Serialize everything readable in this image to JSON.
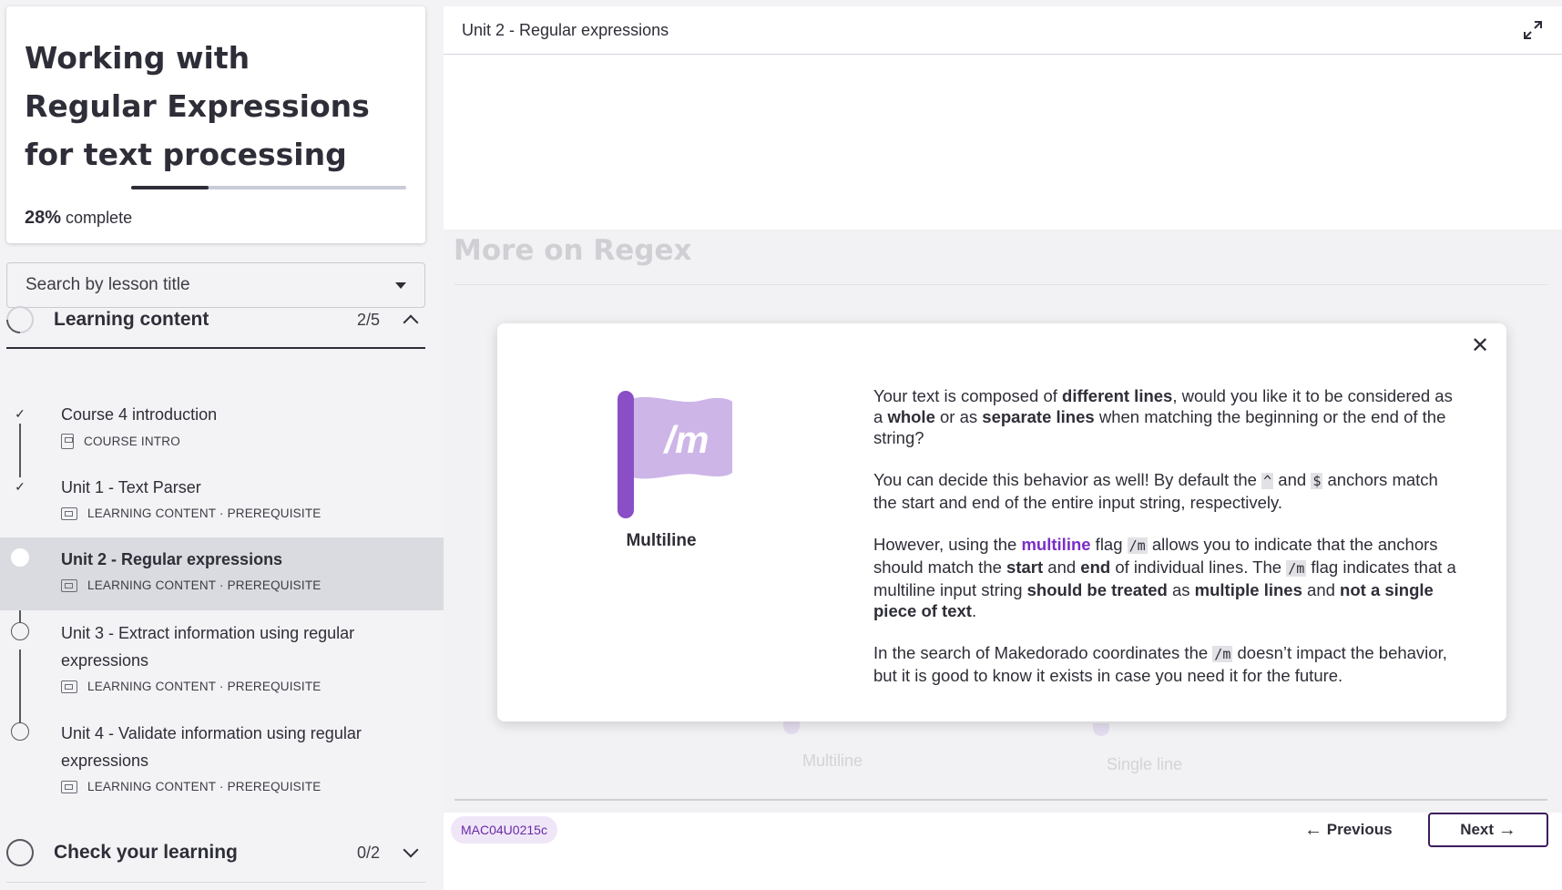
{
  "course": {
    "title": "Working with Regular Expressions for text processing",
    "progress_percent": 28,
    "progress_value": "28%",
    "progress_suffix": "complete"
  },
  "search": {
    "placeholder": "Search by lesson title"
  },
  "sections": [
    {
      "title": "Learning content",
      "count": "2/5",
      "expanded": true,
      "lessons": [
        {
          "title": "Course 4 introduction",
          "meta": "COURSE INTRO",
          "state": "completed"
        },
        {
          "title": "Unit 1 - Text Parser",
          "meta": "LEARNING CONTENT · PREREQUISITE",
          "state": "completed"
        },
        {
          "title": "Unit 2 - Regular expressions",
          "meta": "LEARNING CONTENT · PREREQUISITE",
          "state": "active"
        },
        {
          "title": "Unit 3 - Extract information using regular expressions",
          "meta": "LEARNING CONTENT · PREREQUISITE",
          "state": "not-started"
        },
        {
          "title": "Unit 4 - Validate information using regular expressions",
          "meta": "LEARNING CONTENT · PREREQUISITE",
          "state": "not-started"
        }
      ]
    },
    {
      "title": "Check your learning",
      "count": "0/2",
      "expanded": false
    }
  ],
  "main": {
    "header_title": "Unit 2 - Regular expressions",
    "faded_title": "More on Regex",
    "faded_labels": {
      "left": "Multiline",
      "right": "Single line"
    },
    "lesson_code": "MAC04U0215c",
    "prev_label": "Previous",
    "next_label": "Next"
  },
  "modal": {
    "flag_text": "/m",
    "flag_caption": "Multiline",
    "paragraphs": {
      "p1_a": "Your text is composed of ",
      "p1_b": "different lines",
      "p1_c": ", would you like it to be considered as a ",
      "p1_d": "whole",
      "p1_e": " or as ",
      "p1_f": "separate lines",
      "p1_g": " when matching the beginning or the end of the string?",
      "p2_a": "You can decide this behavior as well! By default the ",
      "p2_code1": "^",
      "p2_b": " and ",
      "p2_code2": "$",
      "p2_c": " anchors match the start and end of the entire input string, respectively.",
      "p3_a": "However, using the ",
      "p3_hl": "multiline",
      "p3_b": " flag ",
      "p3_code1": "/m",
      "p3_c": " allows you to indicate that the anchors should match the ",
      "p3_d": "start",
      "p3_e": " and ",
      "p3_f": "end",
      "p3_g": " of individual lines. The ",
      "p3_code2": "/m",
      "p3_h": " flag indicates that a multiline input string ",
      "p3_i": "should be treated",
      "p3_j": " as ",
      "p3_k": "multiple lines",
      "p3_l": " and ",
      "p3_m": "not a single piece of text",
      "p3_n": ".",
      "p4_a": "In the search of Makedorado coordinates the ",
      "p4_code": "/m",
      "p4_b": " doesn’t impact the behavior, but it is good to know it exists in case you need it for the future."
    }
  },
  "colors": {
    "accent_purple": "#7a2ec6",
    "flag_light": "#cdb5e8",
    "flag_pole": "#8a4fc6",
    "active_row": "#dadbe0"
  }
}
